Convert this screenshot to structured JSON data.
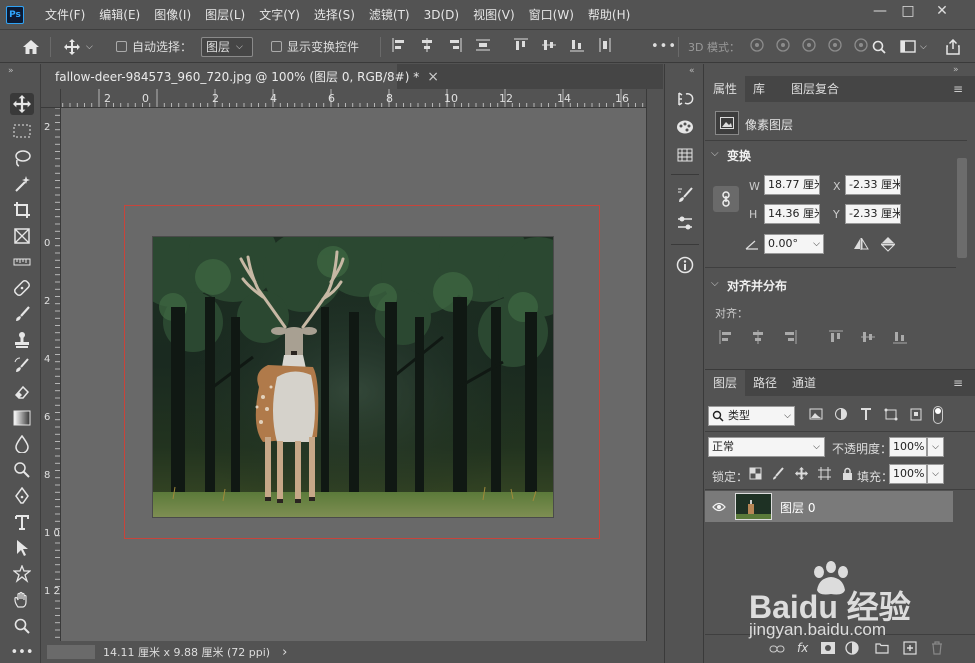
{
  "app": {
    "logo_text": "Ps"
  },
  "menu": [
    "文件(F)",
    "编辑(E)",
    "图像(I)",
    "图层(L)",
    "文字(Y)",
    "选择(S)",
    "滤镜(T)",
    "3D(D)",
    "视图(V)",
    "窗口(W)",
    "帮助(H)"
  ],
  "window_controls": {
    "minimize": "—",
    "maximize": "□",
    "close": "✕"
  },
  "options": {
    "auto_select_label": "自动选择：",
    "auto_select_target": "图层",
    "show_transform_label": "显示变换控件",
    "more": "•••",
    "mode_3d_label": "3D 模式："
  },
  "document": {
    "tab_title": "fallow-deer-984573_960_720.jpg @ 100% (图层 0, RGB/8#) *",
    "close_glyph": "×"
  },
  "ruler": {
    "top": [
      "2",
      "0",
      "2",
      "4",
      "6",
      "8",
      "10",
      "12",
      "14",
      "16"
    ],
    "left": [
      "2",
      "0",
      "2",
      "4",
      "6",
      "8",
      "1\n0",
      "1\n2",
      "1\n4",
      "1\n6"
    ]
  },
  "status": {
    "dimensions": "14.11 厘米 x 9.88 厘米 (72 ppi)",
    "arrow": "›"
  },
  "properties_panel": {
    "tabs": [
      "属性",
      "库",
      "图层复合"
    ],
    "layer_type": "像素图层",
    "transform_header": "变换",
    "w_label": "W",
    "h_label": "H",
    "x_label": "X",
    "y_label": "Y",
    "w_value": "18.77 厘米",
    "h_value": "14.36 厘米",
    "x_value": "-2.33 厘米",
    "y_value": "-2.33 厘米",
    "angle_value": "0.00°",
    "align_header": "对齐并分布",
    "align_label": "对齐："
  },
  "layers_panel": {
    "tabs": [
      "图层",
      "路径",
      "通道"
    ],
    "filter_kind": "类型",
    "blend_mode": "正常",
    "opacity_label": "不透明度：",
    "opacity_value": "100%",
    "lock_label": "锁定：",
    "fill_label": "填充：",
    "fill_value": "100%",
    "layers": [
      {
        "name": "图层 0",
        "visible": true
      }
    ],
    "footer_fx": "fx"
  },
  "watermark": {
    "brand": "Baidu 经验",
    "url": "jingyan.baidu.com"
  },
  "colors": {
    "accent_ps": "#31a8ff",
    "artboard_border": "#c8443b",
    "canvas_bg": "#696969",
    "ui_bg": "#535353"
  }
}
